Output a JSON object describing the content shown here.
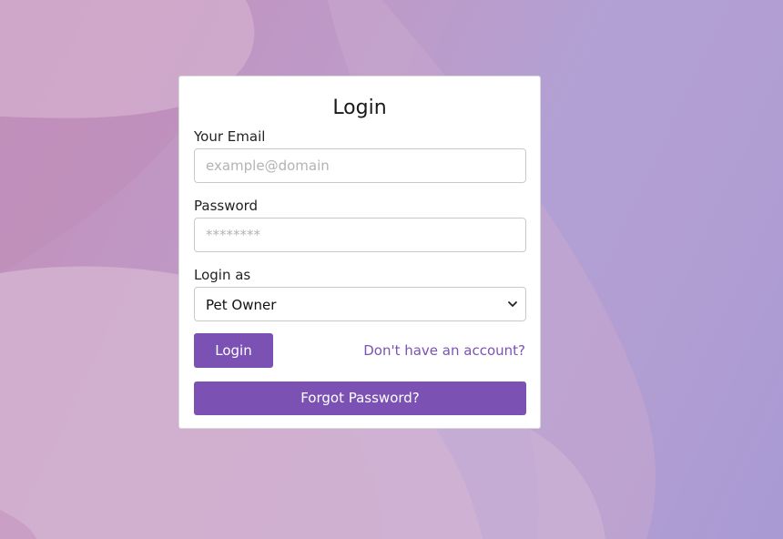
{
  "login_form": {
    "title": "Login",
    "email_label": "Your Email",
    "email_placeholder": "example@domain",
    "email_value": "",
    "password_label": "Password",
    "password_placeholder": "********",
    "password_value": "",
    "role_label": "Login as",
    "role_selected": "Pet Owner",
    "login_button": "Login",
    "signup_link": "Don't have an account?",
    "forgot_button": "Forgot Password?"
  },
  "colors": {
    "accent": "#7b52b3",
    "card": "#ffffff",
    "background_pink": "#c48fba",
    "background_purple": "#a99ad4"
  }
}
